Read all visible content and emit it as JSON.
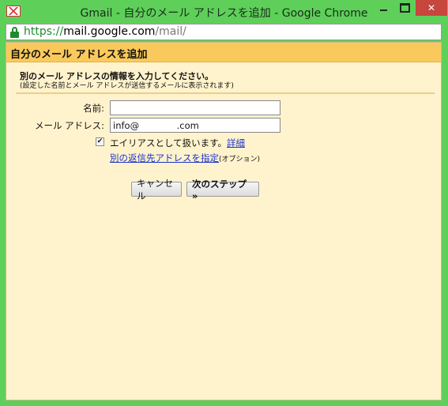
{
  "window": {
    "title": "Gmail - 自分のメール アドレスを追加 - Google Chrome",
    "close_glyph": "✕"
  },
  "address_bar": {
    "scheme": "https://",
    "host": "mail.google.com",
    "path": "/mail/"
  },
  "page": {
    "header_title": "自分のメール アドレスを追加",
    "section_title": "別のメール アドレスの情報を入力してください。",
    "section_note": "(設定した名前とメール アドレスが送信するメールに表示されます)",
    "form": {
      "name_label": "名前:",
      "name_value": "",
      "email_label": "メール アドレス:",
      "email_value": "info@             .com",
      "alias_checkbox_checked": true,
      "alias_checkbox_glyph": "✔",
      "alias_text": "エイリアスとして扱います。",
      "alias_link": "詳細",
      "replyto_link": "別の返信先アドレスを指定",
      "replyto_note": "(オプション)"
    },
    "buttons": {
      "cancel": "キャンセル",
      "next": "次のステップ »"
    }
  },
  "colors": {
    "frame": "#5ed05a",
    "header": "#fac95b",
    "content_bg": "#fff3cd",
    "link": "#1c33cc",
    "close_button": "#c7463e"
  }
}
